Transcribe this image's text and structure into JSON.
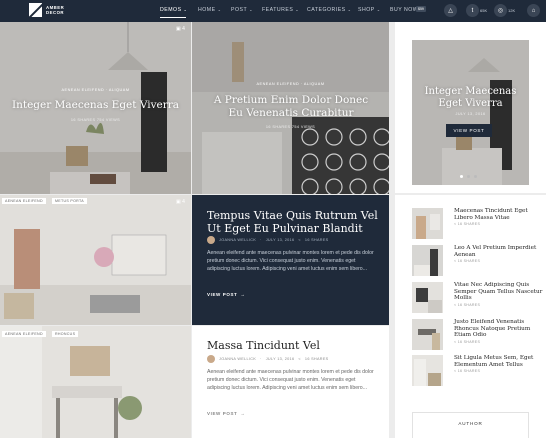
{
  "brand": {
    "name": "AMBER DECOR",
    "logo_letter": ""
  },
  "nav": {
    "items": [
      {
        "label": "DEMOS",
        "has_chevron": true
      },
      {
        "label": "HOME",
        "has_chevron": true
      },
      {
        "label": "POST",
        "has_chevron": true
      },
      {
        "label": "FEATURES",
        "has_chevron": true
      },
      {
        "label": "CATEGORIES",
        "has_chevron": true
      },
      {
        "label": "SHOP",
        "has_chevron": true
      },
      {
        "label": "BUY NOW",
        "has_chevron": false
      }
    ],
    "buy_badge": "$59",
    "chevron": "⌄",
    "social": [
      {
        "icon": "triangle-icon",
        "glyph": "△",
        "count": ""
      },
      {
        "icon": "twitter-icon",
        "glyph": "t",
        "count": "65K"
      },
      {
        "icon": "instagram-icon",
        "glyph": "◎",
        "count": "12K"
      },
      {
        "icon": "shopping-bag-icon",
        "glyph": "⌂",
        "count": ""
      }
    ]
  },
  "tiles": [
    {
      "category": "AENEAN ELEIFEND · ALIQUAM",
      "title": "Integer Maecenas Eget Viverra",
      "meta": "16 SHARES        754 VIEWS",
      "gallery_count": "4"
    },
    {
      "category": "AENEAN ELEIFEND · ALIQUAM",
      "title": "A Pretium Enim Dolor Donec Eu Venenatis Curabitur",
      "meta": "16 SHARES        754 VIEWS",
      "gallery_count": ""
    },
    {
      "tags": [
        "AENEAN ELEIFEND",
        "METUS PORTA"
      ],
      "gallery_count": "4"
    },
    {
      "tags": [
        "AENEAN ELEIFEND",
        "RHONCUS"
      ]
    }
  ],
  "cards": [
    {
      "title": "Tempus Vitae Quis Rutrum Vel Ut Eget Eu Pulvinar Blandit",
      "author": "JOANNA WELLICK",
      "date": "JULY 13, 2016",
      "shares": "16 SHARES",
      "excerpt": "Aenean eleifend ante maecenas pulvinar montes lorem et pede dis dolor pretium donec dictum. Vici consequat justo enim. Venenatis eget adipiscing luctus lorem. Adipiscing veni amet luctus enim sem libero...",
      "cta": "VIEW POST"
    },
    {
      "title": "Massa Tincidunt Vel",
      "author": "JOANNA WELLICK",
      "date": "JULY 13, 2016",
      "shares": "16 SHARES",
      "excerpt": "Aenean eleifend ante maecenas pulvinar montes lorem et pede dis dolor pretium donec dictum. Vici consequat justo enim. Venenatis eget adipiscing luctus lorem. Adipiscing veni amet luctus enim sem libero...",
      "cta": "VIEW POST"
    }
  ],
  "sidebar": {
    "slider": {
      "title": "Integer Maecenas Eget Viverra",
      "date": "JULY 13, 2016",
      "cta": "VIEW POST",
      "dots": 3,
      "active_dot": 0
    },
    "posts": [
      {
        "title": "Maecenas Tincidunt Eget Libero Massa Vitae",
        "shares": "16 SHARES"
      },
      {
        "title": "Leo A Vel Pretium Imperdiet Aenean",
        "shares": "16 SHARES"
      },
      {
        "title": "Vitae Nec Adipiscing Quis Semper Quam Tellus Nascetur Mollis",
        "shares": "16 SHARES"
      },
      {
        "title": "Justo Eleifend Venenatis Rhoncus Natoque Pretium Etiam Odio",
        "shares": "16 SHARES"
      },
      {
        "title": "Sit Ligula Metus Sem, Eget Elementum Amet Tellus",
        "shares": "16 SHARES"
      }
    ],
    "author_heading": "AUTHOR"
  },
  "colors": {
    "navy": "#1f2a3a",
    "accent_blue": "#7a8fa8",
    "page_bg": "#ececec"
  }
}
